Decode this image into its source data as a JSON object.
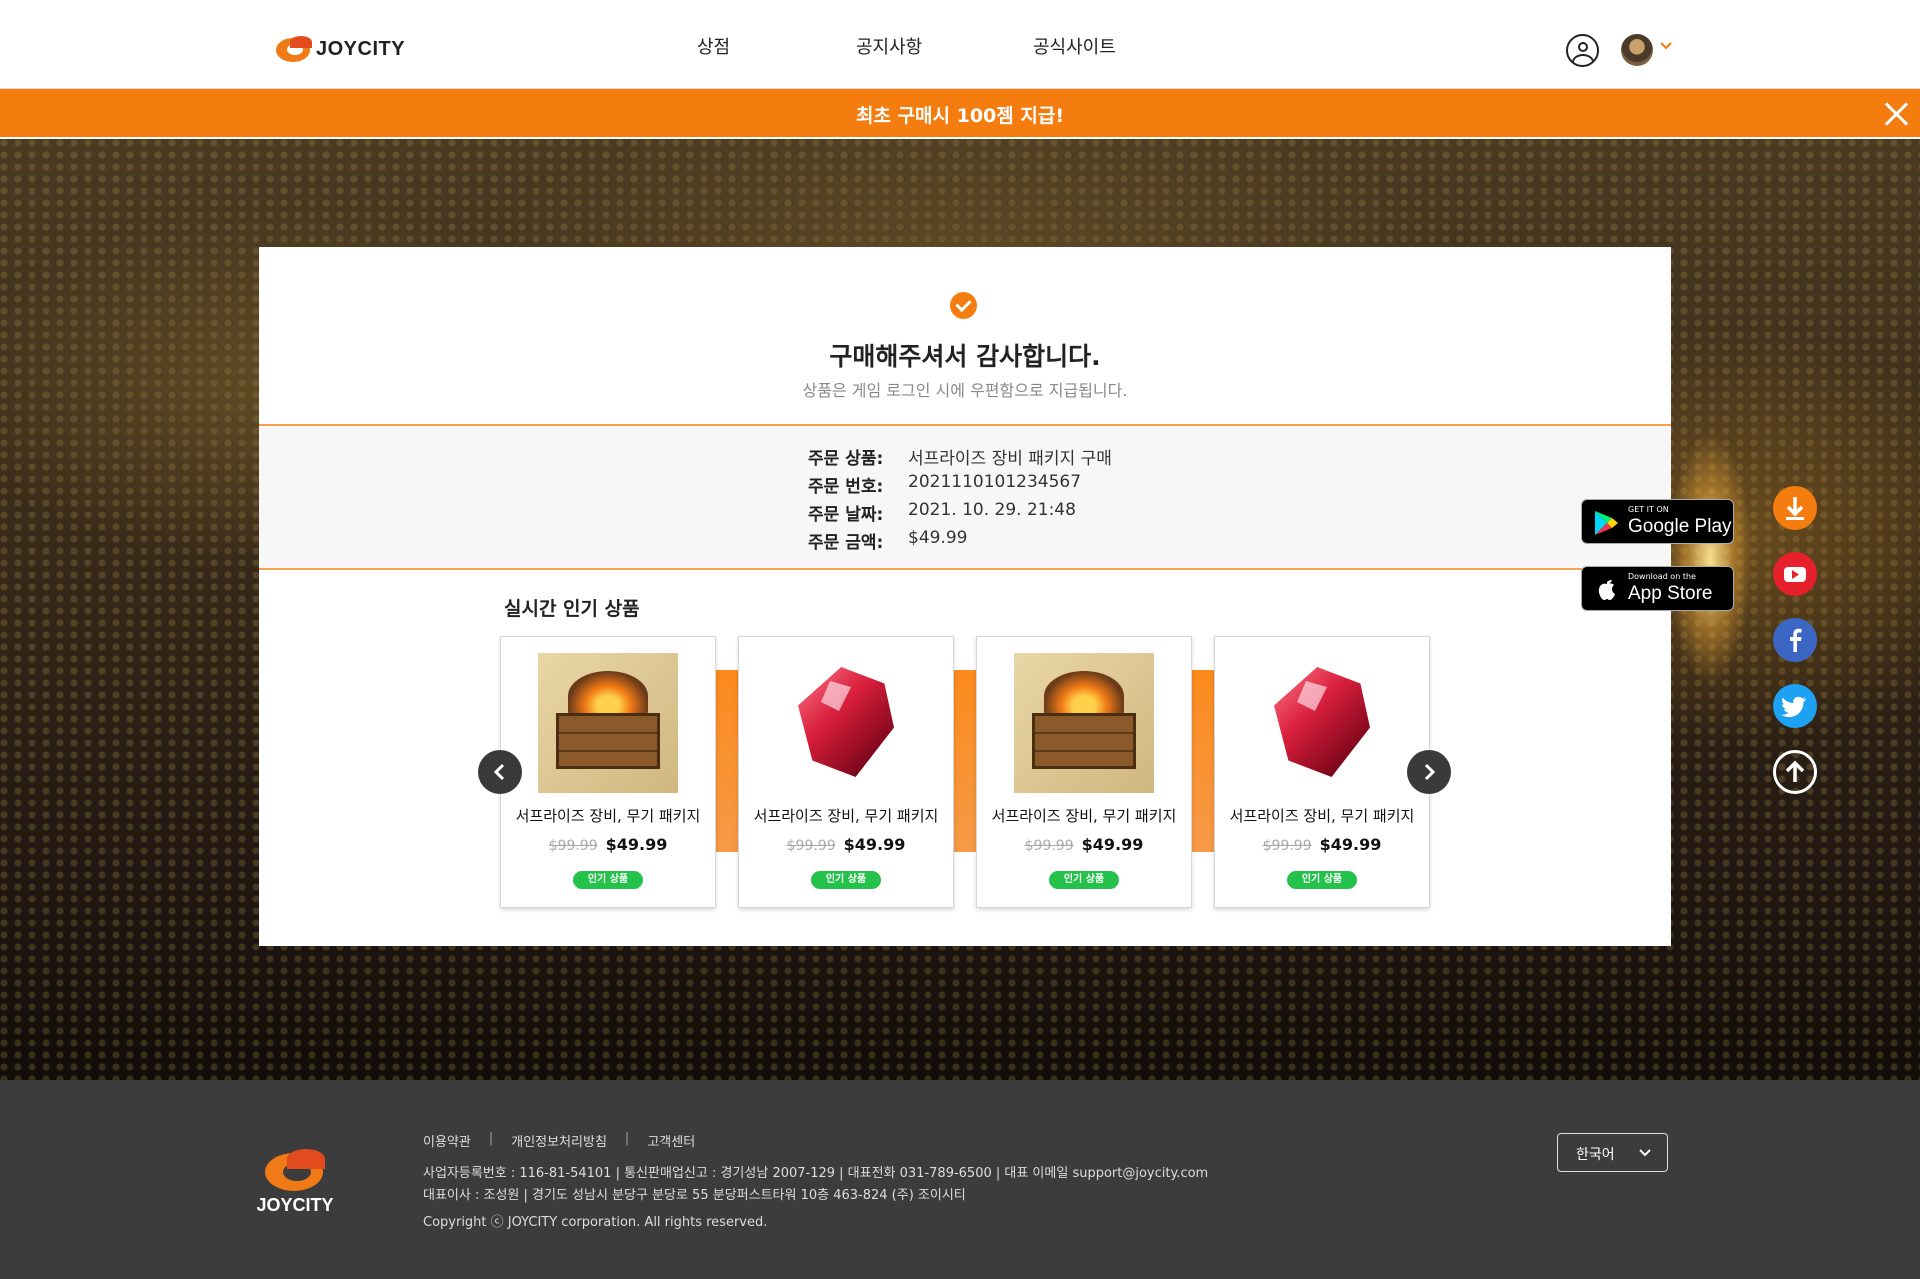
{
  "header": {
    "logo_text": "JOYCITY",
    "nav": [
      "상점",
      "공지사항",
      "공식사이트"
    ]
  },
  "promo": {
    "text": "최초 구매시 100젬 지급!"
  },
  "confirmation": {
    "title": "구매해주셔서 감사합니다.",
    "subtitle": "상품은 게임 로그인 시에 우편함으로 지급됩니다.",
    "order": [
      {
        "label": "주문 상품:",
        "value": "서프라이즈 장비 패키지 구매"
      },
      {
        "label": "주문 번호:",
        "value": "2021110101234567"
      },
      {
        "label": "주문 날짜:",
        "value": "2021. 10. 29. 21:48"
      },
      {
        "label": "주문 금액:",
        "value": "$49.99"
      }
    ]
  },
  "popular": {
    "title": "실시간 인기 상품",
    "products": [
      {
        "name": "서프라이즈 장비, 무기 패키지",
        "old_price": "$99.99",
        "price": "$49.99",
        "badge": "인기 상품",
        "image": "crate-icon"
      },
      {
        "name": "서프라이즈 장비, 무기 패키지",
        "old_price": "$99.99",
        "price": "$49.99",
        "badge": "인기 상품",
        "image": "gem-icon"
      },
      {
        "name": "서프라이즈 장비, 무기 패키지",
        "old_price": "$99.99",
        "price": "$49.99",
        "badge": "인기 상품",
        "image": "crate-icon"
      },
      {
        "name": "서프라이즈 장비, 무기 패키지",
        "old_price": "$99.99",
        "price": "$49.99",
        "badge": "인기 상품",
        "image": "gem-icon"
      }
    ]
  },
  "stores": {
    "google_small": "GET IT ON",
    "google_big": "Google Play",
    "apple_small": "Download on the",
    "apple_big": "App Store"
  },
  "footer": {
    "logo_text": "JOYCITY",
    "links": [
      "이용약관",
      "개인정보처리방침",
      "고객센터"
    ],
    "info_line1": "사업자등록번호 : 116-81-54101 | 통신판매업신고 : 경기성남 2007-129 | 대표전화 031-789-6500 | 대표 이메일 support@joycity.com",
    "info_line2": "대표이사 : 조성원 | 경기도 성남시 분당구 분당로 55 분당퍼스트타워 10층 463-824 (주) 조이시티",
    "copyright": "Copyright ⓒ JOYCITY corporation. All rights reserved.",
    "language": "한국어"
  },
  "colors": {
    "accent": "#f57d0f",
    "badge": "#24c24a"
  }
}
